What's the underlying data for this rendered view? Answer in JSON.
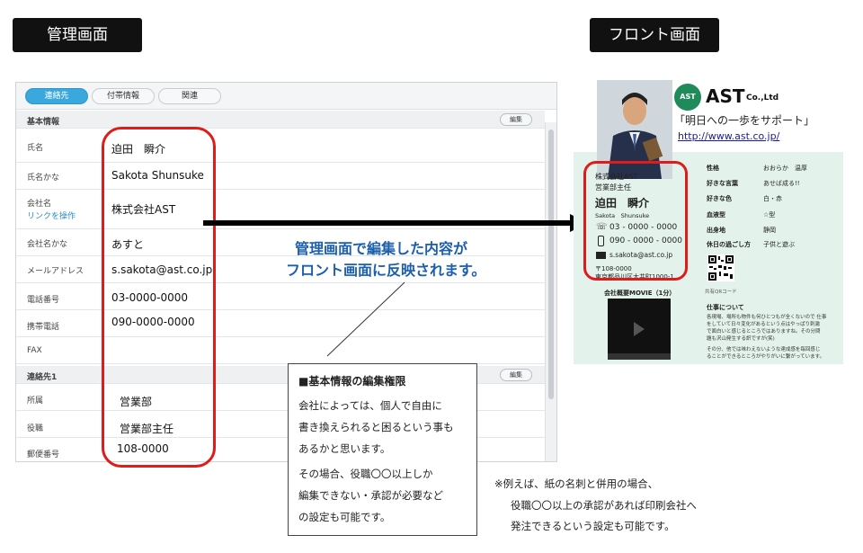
{
  "headers": {
    "admin": "管理画面",
    "front": "フロント画面"
  },
  "admin": {
    "tabs": [
      "連絡先",
      "付帯情報",
      "関連"
    ],
    "section_basic": "基本情報",
    "section_contact": "連絡先1",
    "edit_label": "編集",
    "fields": [
      {
        "label": "氏名",
        "value": "迫田　瞬介"
      },
      {
        "label": "氏名かな",
        "value": "Sakota Shunsuke"
      },
      {
        "label": "会社名",
        "sublink": "リンクを操作",
        "value": "株式会社AST"
      },
      {
        "label": "会社名かな",
        "value": "あすと"
      },
      {
        "label": "メールアドレス",
        "value": "s.sakota@ast.co.jp"
      },
      {
        "label": "電話番号",
        "value": "03-0000-0000"
      },
      {
        "label": "携帯電話",
        "value": "090-0000-0000"
      },
      {
        "label": "FAX",
        "value": ""
      }
    ],
    "contact_fields": [
      {
        "label": "所属",
        "value": "営業部"
      },
      {
        "label": "役職",
        "value": "営業部主任"
      },
      {
        "label": "郵便番号",
        "value": "108-0000"
      }
    ]
  },
  "message": {
    "line1": "管理画面で編集した内容が",
    "line2": "フロント画面に反映されます。"
  },
  "callout": {
    "heading": "■基本情報の編集権限",
    "p1": [
      "会社によっては、個人で自由に",
      "書き換えられると困るという事も",
      "あるかと思います。"
    ],
    "p2": [
      "その場合、役職〇〇以上しか",
      "編集できない・承認が必要など",
      "の設定も可能です。"
    ]
  },
  "note": [
    "※例えば、紙の名刺と併用の場合、",
    "役職〇〇以上の承認があれば印刷会社へ",
    "発注できるという設定も可能です。"
  ],
  "front": {
    "logo_badge": "AST",
    "logo_text": "AST",
    "logo_suffix": "Co.,Ltd",
    "tagline": "「明日への一歩をサポート」",
    "url": "http://www.ast.co.jp/",
    "company": "株式会社AST",
    "position": "営業部主任",
    "name": "迫田　瞬介",
    "name_kana": "Sakota　Shunsuke",
    "tel": "03 - 0000 - 0000",
    "mobile": "090 - 0000 - 0000",
    "email": "s.sakota@ast.co.jp",
    "postal": "〒108-0000",
    "address": "東京都品川区大井町1000-1",
    "qr_caption": "共有QRコード",
    "movie_label": "会社概要MOVIE（1分）",
    "profile": [
      {
        "k": "性格",
        "v": "おおらか　温厚"
      },
      {
        "k": "好きな言葉",
        "v": "あせば成る!!"
      },
      {
        "k": "好きな色",
        "v": "白・赤"
      },
      {
        "k": "血液型",
        "v": "☆型"
      },
      {
        "k": "出身地",
        "v": "静岡"
      },
      {
        "k": "休日の過ごし方",
        "v": "子供と遊ぶ"
      }
    ],
    "work_title": "仕事について",
    "work_p1": [
      "各現場、場所も物件も何ひとつもが全くないので 仕事",
      "をしていて日々変化があるという点はやっぱり刺激",
      "で面白いと感じるところではありますね。その分問",
      "題も沢山発生する訳ですが(笑)"
    ],
    "work_p2": [
      "その分、他では味わえないような達成感を毎回感じ",
      "ることができるところがやりがいに繋がっています。"
    ]
  },
  "colors": {
    "accent_blue": "#3aa8dd",
    "message_blue": "#1b5fae",
    "red_outline": "#e01b1b",
    "link_blue": "#1a1a9a"
  }
}
